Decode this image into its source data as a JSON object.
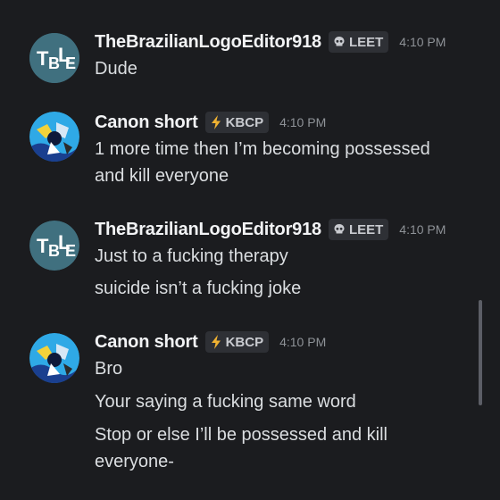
{
  "messages": [
    {
      "username": "TheBrazilianLogoEditor918",
      "tag": "LEET",
      "tag_icon": "skull-icon",
      "time": "4:10 PM",
      "avatar": "table-logo-avatar",
      "lines": [
        "Dude"
      ]
    },
    {
      "username": "Canon short",
      "tag": "KBCP",
      "tag_icon": "lightning-icon",
      "time": "4:10 PM",
      "avatar": "blue-character-avatar",
      "lines": [
        "1 more time then I’m becoming possessed",
        "and kill everyone"
      ]
    },
    {
      "username": "TheBrazilianLogoEditor918",
      "tag": "LEET",
      "tag_icon": "skull-icon",
      "time": "4:10 PM",
      "avatar": "table-logo-avatar",
      "lines": [
        "Just to a fucking therapy",
        "suicide isn’t a fucking joke"
      ]
    },
    {
      "username": "Canon short",
      "tag": "KBCP",
      "tag_icon": "lightning-icon",
      "time": "4:10 PM",
      "avatar": "blue-character-avatar",
      "lines": [
        "Bro",
        "Your saying a fucking same word",
        "Stop or else I’ll be possessed and kill",
        "everyone-"
      ]
    }
  ],
  "colors": {
    "background": "#1b1c1f",
    "username": "#f2f3f5",
    "text": "#dbdee1",
    "timestamp": "#8e9297",
    "tag_background": "#2e3035",
    "lightning": "#f0b232"
  }
}
